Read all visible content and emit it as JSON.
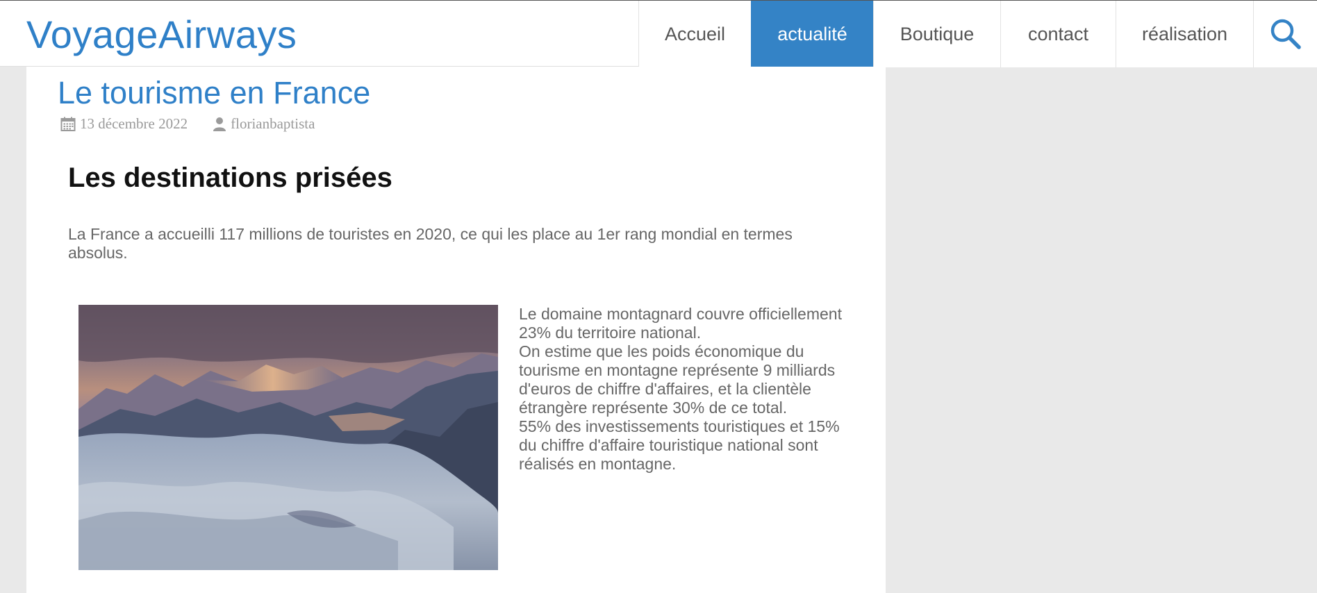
{
  "site": {
    "logo": "VoyageAirways"
  },
  "nav": {
    "items": [
      {
        "label": "Accueil"
      },
      {
        "label": "actualité",
        "active": true
      },
      {
        "label": "Boutique"
      },
      {
        "label": "contact"
      },
      {
        "label": "réalisation"
      }
    ],
    "search_icon": "search-icon"
  },
  "post": {
    "title": "Le tourisme en France",
    "date": "13 décembre 2022",
    "author": "florianbaptista",
    "date_icon": "calendar-icon",
    "author_icon": "user-icon"
  },
  "article": {
    "heading": "Les destinations prisées",
    "intro": "La France a accueilli 117 millions de touristes en 2020, ce qui les place au 1er rang mondial en termes absolus.",
    "side_paragraphs": [
      "Le domaine montagnard couvre officiellement 23% du territoire national.",
      "On estime que les poids économique du tourisme en montagne représente 9 milliards d'euros de chiffre d'affaires, et la clientèle étrangère représente 30% de ce total.",
      "55% des investissements touristiques et 15% du chiffre d'affaire touristique national sont réalisés en montagne."
    ]
  },
  "colors": {
    "accent": "#2f80c8",
    "nav_active_bg": "#3483c6",
    "page_bg": "#e9e9e9"
  }
}
